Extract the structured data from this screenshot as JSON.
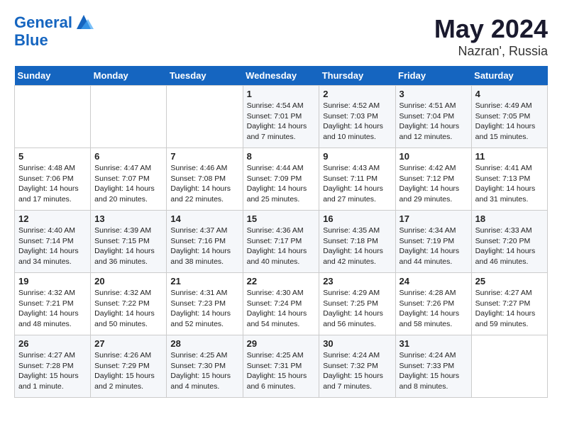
{
  "header": {
    "logo_line1": "General",
    "logo_line2": "Blue",
    "title": "May 2024",
    "subtitle": "Nazran', Russia"
  },
  "weekdays": [
    "Sunday",
    "Monday",
    "Tuesday",
    "Wednesday",
    "Thursday",
    "Friday",
    "Saturday"
  ],
  "weeks": [
    [
      {
        "day": "",
        "info": ""
      },
      {
        "day": "",
        "info": ""
      },
      {
        "day": "",
        "info": ""
      },
      {
        "day": "1",
        "info": "Sunrise: 4:54 AM\nSunset: 7:01 PM\nDaylight: 14 hours\nand 7 minutes."
      },
      {
        "day": "2",
        "info": "Sunrise: 4:52 AM\nSunset: 7:03 PM\nDaylight: 14 hours\nand 10 minutes."
      },
      {
        "day": "3",
        "info": "Sunrise: 4:51 AM\nSunset: 7:04 PM\nDaylight: 14 hours\nand 12 minutes."
      },
      {
        "day": "4",
        "info": "Sunrise: 4:49 AM\nSunset: 7:05 PM\nDaylight: 14 hours\nand 15 minutes."
      }
    ],
    [
      {
        "day": "5",
        "info": "Sunrise: 4:48 AM\nSunset: 7:06 PM\nDaylight: 14 hours\nand 17 minutes."
      },
      {
        "day": "6",
        "info": "Sunrise: 4:47 AM\nSunset: 7:07 PM\nDaylight: 14 hours\nand 20 minutes."
      },
      {
        "day": "7",
        "info": "Sunrise: 4:46 AM\nSunset: 7:08 PM\nDaylight: 14 hours\nand 22 minutes."
      },
      {
        "day": "8",
        "info": "Sunrise: 4:44 AM\nSunset: 7:09 PM\nDaylight: 14 hours\nand 25 minutes."
      },
      {
        "day": "9",
        "info": "Sunrise: 4:43 AM\nSunset: 7:11 PM\nDaylight: 14 hours\nand 27 minutes."
      },
      {
        "day": "10",
        "info": "Sunrise: 4:42 AM\nSunset: 7:12 PM\nDaylight: 14 hours\nand 29 minutes."
      },
      {
        "day": "11",
        "info": "Sunrise: 4:41 AM\nSunset: 7:13 PM\nDaylight: 14 hours\nand 31 minutes."
      }
    ],
    [
      {
        "day": "12",
        "info": "Sunrise: 4:40 AM\nSunset: 7:14 PM\nDaylight: 14 hours\nand 34 minutes."
      },
      {
        "day": "13",
        "info": "Sunrise: 4:39 AM\nSunset: 7:15 PM\nDaylight: 14 hours\nand 36 minutes."
      },
      {
        "day": "14",
        "info": "Sunrise: 4:37 AM\nSunset: 7:16 PM\nDaylight: 14 hours\nand 38 minutes."
      },
      {
        "day": "15",
        "info": "Sunrise: 4:36 AM\nSunset: 7:17 PM\nDaylight: 14 hours\nand 40 minutes."
      },
      {
        "day": "16",
        "info": "Sunrise: 4:35 AM\nSunset: 7:18 PM\nDaylight: 14 hours\nand 42 minutes."
      },
      {
        "day": "17",
        "info": "Sunrise: 4:34 AM\nSunset: 7:19 PM\nDaylight: 14 hours\nand 44 minutes."
      },
      {
        "day": "18",
        "info": "Sunrise: 4:33 AM\nSunset: 7:20 PM\nDaylight: 14 hours\nand 46 minutes."
      }
    ],
    [
      {
        "day": "19",
        "info": "Sunrise: 4:32 AM\nSunset: 7:21 PM\nDaylight: 14 hours\nand 48 minutes."
      },
      {
        "day": "20",
        "info": "Sunrise: 4:32 AM\nSunset: 7:22 PM\nDaylight: 14 hours\nand 50 minutes."
      },
      {
        "day": "21",
        "info": "Sunrise: 4:31 AM\nSunset: 7:23 PM\nDaylight: 14 hours\nand 52 minutes."
      },
      {
        "day": "22",
        "info": "Sunrise: 4:30 AM\nSunset: 7:24 PM\nDaylight: 14 hours\nand 54 minutes."
      },
      {
        "day": "23",
        "info": "Sunrise: 4:29 AM\nSunset: 7:25 PM\nDaylight: 14 hours\nand 56 minutes."
      },
      {
        "day": "24",
        "info": "Sunrise: 4:28 AM\nSunset: 7:26 PM\nDaylight: 14 hours\nand 58 minutes."
      },
      {
        "day": "25",
        "info": "Sunrise: 4:27 AM\nSunset: 7:27 PM\nDaylight: 14 hours\nand 59 minutes."
      }
    ],
    [
      {
        "day": "26",
        "info": "Sunrise: 4:27 AM\nSunset: 7:28 PM\nDaylight: 15 hours\nand 1 minute."
      },
      {
        "day": "27",
        "info": "Sunrise: 4:26 AM\nSunset: 7:29 PM\nDaylight: 15 hours\nand 2 minutes."
      },
      {
        "day": "28",
        "info": "Sunrise: 4:25 AM\nSunset: 7:30 PM\nDaylight: 15 hours\nand 4 minutes."
      },
      {
        "day": "29",
        "info": "Sunrise: 4:25 AM\nSunset: 7:31 PM\nDaylight: 15 hours\nand 6 minutes."
      },
      {
        "day": "30",
        "info": "Sunrise: 4:24 AM\nSunset: 7:32 PM\nDaylight: 15 hours\nand 7 minutes."
      },
      {
        "day": "31",
        "info": "Sunrise: 4:24 AM\nSunset: 7:33 PM\nDaylight: 15 hours\nand 8 minutes."
      },
      {
        "day": "",
        "info": ""
      }
    ]
  ]
}
